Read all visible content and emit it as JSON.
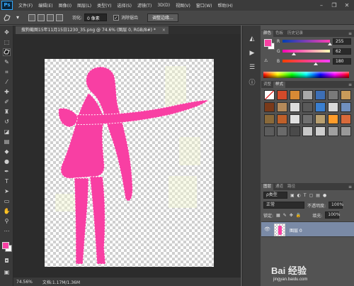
{
  "app": {
    "logo": "Ps",
    "menu": [
      "文件(F)",
      "编辑(E)",
      "图像(I)",
      "图层(L)",
      "类型(Y)",
      "选择(S)",
      "滤镜(T)",
      "3D(D)",
      "视图(V)",
      "窗口(W)",
      "帮助(H)"
    ],
    "window_controls": {
      "minimize": "–",
      "restore": "❐",
      "close": "✕"
    }
  },
  "options_bar": {
    "feather_label": "羽化:",
    "feather_value": "0 像素",
    "antialias_checked": true,
    "antialias_label": "消除锯齿",
    "refine_edge_label": "调整边缘..."
  },
  "document": {
    "tab_title": "搜狗截图15年11月15日1230_35.png @ 74.6% (图层 0, RGB/8#) *",
    "tab_close": "×",
    "silhouette_color": "#f83fa3",
    "marching_ants_color": "#ffffff"
  },
  "status_bar": {
    "zoom": "74.56%",
    "doc_size": "文档:1.17M/1.36M"
  },
  "color_panel": {
    "tabs": [
      "颜色",
      "色板",
      "历史记录"
    ],
    "foreground": "#f83fa3",
    "background": "#ffffff",
    "channels": [
      {
        "label": "R",
        "value": "255",
        "fraction": 1.0,
        "gradient": "linear-gradient(90deg,#003eb4,#ff3eb4)"
      },
      {
        "label": "G",
        "value": "62",
        "fraction": 0.243,
        "gradient": "linear-gradient(90deg,#ff00b4,#ffffb4)"
      },
      {
        "label": "B",
        "value": "180",
        "fraction": 0.706,
        "gradient": "linear-gradient(90deg,#ff3e00,#ff3eff)"
      }
    ],
    "warning_icon": "⚠"
  },
  "styles_panel": {
    "tabs": [
      "调整",
      "样式"
    ],
    "swatches": [
      "#ffffff",
      "#d44a2a",
      "#d88a35",
      "#a9a9a9",
      "#3d6fb6",
      "#7a7a7a",
      "#c99b5a",
      "#7a3a1a",
      "#b58a5a",
      "#dcdcdc",
      "#5a5a5a",
      "#3a7fd0",
      "#d8d8d8",
      "#7090c0",
      "#8a6a3a",
      "#c0602a",
      "#e0e0e0",
      "#707070",
      "#b9a070",
      "#ff9c2a",
      "#d96a3a",
      "#5d5d5d",
      "#6a6a6a",
      "#4a4a4a",
      "#c7c7c7",
      "#cfcfcf",
      "#a0a0a0",
      "#999999"
    ]
  },
  "layers_panel": {
    "tabs": [
      "图层",
      "通道",
      "路径"
    ],
    "kind_filter": "ρ类型",
    "blend_mode": "正常",
    "opacity_label": "不透明度:",
    "opacity_value": "100%",
    "lock_label": "锁定:",
    "fill_label": "填充:",
    "fill_value": "100%",
    "layers": [
      {
        "name": "图层 0",
        "visible": true
      }
    ]
  },
  "watermark": {
    "brand": "Bai 经验",
    "url": "jingyan.baidu.com"
  }
}
